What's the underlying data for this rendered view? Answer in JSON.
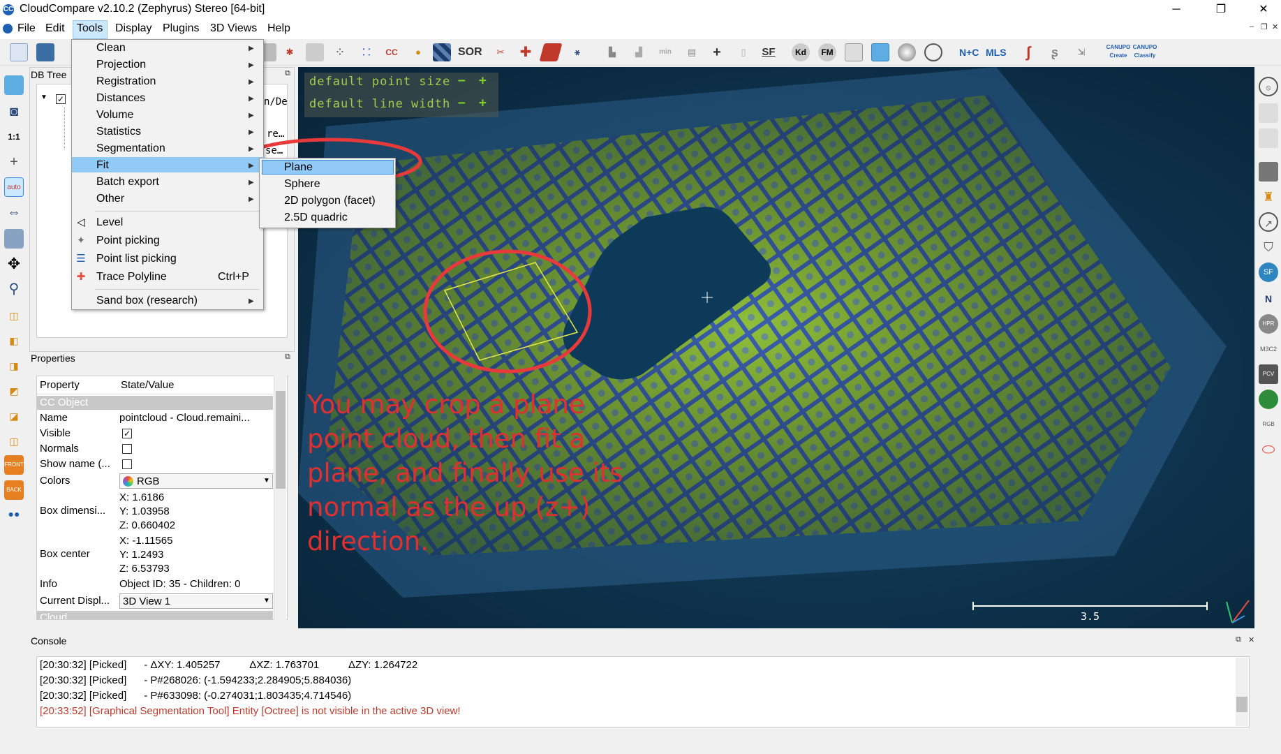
{
  "window": {
    "title": "CloudCompare v2.10.2 (Zephyrus) Stereo [64-bit]",
    "app_icon": "CC",
    "minimize": "─",
    "restore": "❐",
    "close": "✕"
  },
  "menubar": {
    "items": [
      "File",
      "Edit",
      "Tools",
      "Display",
      "Plugins",
      "3D Views",
      "Help"
    ],
    "mdi_minimize": "–",
    "mdi_restore": "❐",
    "mdi_close": "✕"
  },
  "toolbar": {
    "labels": [
      "SOR",
      "SF",
      "Kd",
      "FM",
      "N+C",
      "MLS",
      "CANUPO Create",
      "CANUPO Classify"
    ]
  },
  "tools_menu": {
    "items": [
      {
        "label": "Clean",
        "has_submenu": true
      },
      {
        "label": "Projection",
        "has_submenu": true
      },
      {
        "label": "Registration",
        "has_submenu": true
      },
      {
        "label": "Distances",
        "has_submenu": true
      },
      {
        "label": "Volume",
        "has_submenu": true
      },
      {
        "label": "Statistics",
        "has_submenu": true
      },
      {
        "label": "Segmentation",
        "has_submenu": true
      },
      {
        "label": "Fit",
        "has_submenu": true
      },
      {
        "label": "Batch export",
        "has_submenu": true
      },
      {
        "label": "Other",
        "has_submenu": true
      },
      {
        "label": "Level",
        "has_submenu": false
      },
      {
        "label": "Point picking",
        "has_submenu": false
      },
      {
        "label": "Point list picking",
        "has_submenu": false
      },
      {
        "label": "Trace Polyline",
        "shortcut": "Ctrl+P",
        "has_submenu": false
      },
      {
        "label": "Sand box (research)",
        "has_submenu": true
      }
    ],
    "highlighted": "Fit"
  },
  "fit_submenu": {
    "items": [
      "Plane",
      "Sphere",
      "2D polygon (facet)",
      "2.5D quadric"
    ],
    "highlighted": "Plane"
  },
  "db_tree": {
    "title": "DB Tree",
    "partial_texts": [
      "n/De",
      "re…",
      "se…"
    ]
  },
  "properties": {
    "title": "Properties",
    "header_property": "Property",
    "header_value": "State/Value",
    "section": "CC Object",
    "name_key": "Name",
    "name_value": "pointcloud - Cloud.remaini...",
    "visible_key": "Visible",
    "visible_checked": true,
    "normals_key": "Normals",
    "normals_checked": false,
    "showname_key": "Show name (...",
    "showname_checked": false,
    "colors_key": "Colors",
    "colors_value": "RGB",
    "boxdim_key": "Box dimensi...",
    "boxdim_x": "X: 1.6186",
    "boxdim_y": "Y: 1.03958",
    "boxdim_z": "Z: 0.660402",
    "boxcenter_key": "Box center",
    "boxcenter_x": "X: -1.11565",
    "boxcenter_y": "Y: 1.2493",
    "boxcenter_z": "Z: 6.53793",
    "info_key": "Info",
    "info_value": "Object ID: 35 - Children: 0",
    "display_key": "Current Displ...",
    "display_value": "3D View 1",
    "next_section": "Cloud"
  },
  "view3d": {
    "gl_point_size": "default point size",
    "gl_line_width": "default line width",
    "minus": "−",
    "plus": "+",
    "scale_label": "3.5",
    "annotation": "You may crop a plane point cloud, then fit a plane, and finally use its normal as the up (z+) direction.",
    "annotation_color": "#e03030",
    "cloud_color": "#8fbf3a",
    "grid_color": "#3b5fb0"
  },
  "console": {
    "title": "Console",
    "lines": [
      {
        "text": "[20:30:32] [Picked]      - ΔXY: 1.405257          ΔXZ: 1.763701          ΔZY: 1.264722",
        "color": "#000000"
      },
      {
        "text": "[20:30:32] [Picked]      - P#268026: (-1.594233;2.284905;5.884036)",
        "color": "#000000"
      },
      {
        "text": "[20:30:32] [Picked]      - P#633098: (-0.274031;1.803435;4.714546)",
        "color": "#000000"
      },
      {
        "text": "[20:33:52] [Graphical Segmentation Tool] Entity [Octree] is not visible in the active 3D view!",
        "color": "#c0392b"
      }
    ]
  }
}
